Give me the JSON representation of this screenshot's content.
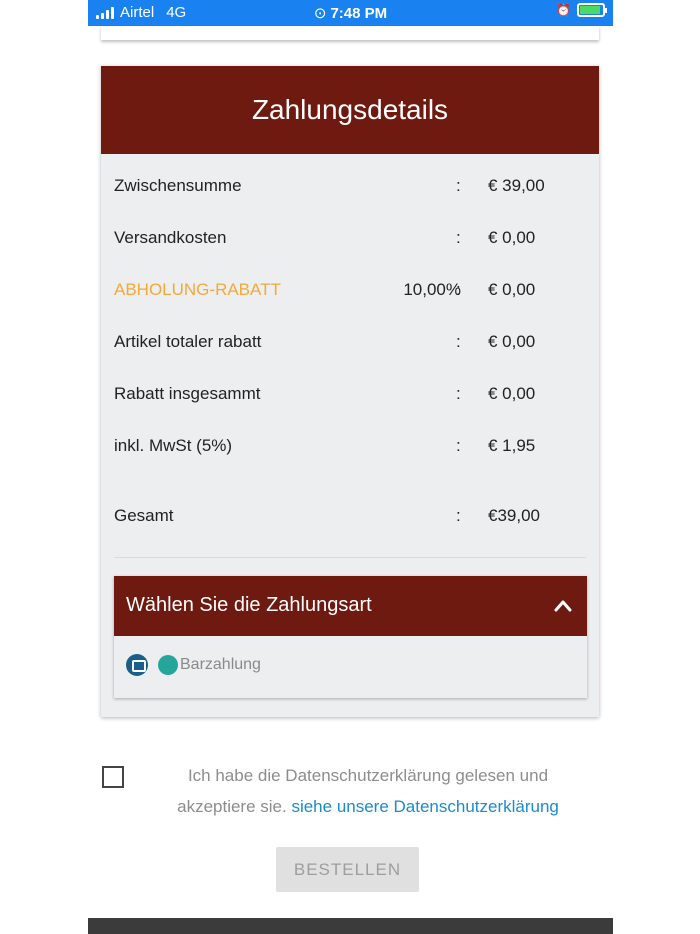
{
  "status_bar": {
    "carrier": "Airtel",
    "network": "4G",
    "time": "7:48 PM",
    "battery_level": 0.85
  },
  "payment_details": {
    "title": "Zahlungsdetails",
    "rows": [
      {
        "label": "Zwischensumme",
        "pct": "",
        "colon": ":",
        "value": "€ 39,00"
      },
      {
        "label": "Versandkosten",
        "pct": "",
        "colon": ":",
        "value": "€ 0,00"
      },
      {
        "label": "ABHOLUNG-RABATT",
        "pct": "10,00%",
        "colon": ":",
        "value": "€ 0,00"
      },
      {
        "label": "Artikel totaler rabatt",
        "pct": "",
        "colon": ":",
        "value": "€ 0,00"
      },
      {
        "label": "Rabatt insgesammt",
        "pct": "",
        "colon": ":",
        "value": "€ 0,00"
      },
      {
        "label": "inkl. MwSt (5%)",
        "pct": "",
        "colon": ":",
        "value": "€ 1,95"
      },
      {
        "label": "Gesamt",
        "pct": "",
        "colon": ":",
        "value": "€39,00"
      }
    ],
    "highlight_color": "#f4a93a",
    "header_color": "#6e1a11"
  },
  "payment_method": {
    "title": "Wählen Sie die Zahlungsart",
    "option_label": "Barzahlung",
    "selected_color": "#26a69a"
  },
  "consent": {
    "text": "Ich habe die Datenschutzerklärung gelesen und akzeptiere sie. ",
    "link_text": "siehe unsere Datenschutzerklärung",
    "link_color": "#1a8ccf"
  },
  "order_button": {
    "label": "BESTELLEN"
  }
}
